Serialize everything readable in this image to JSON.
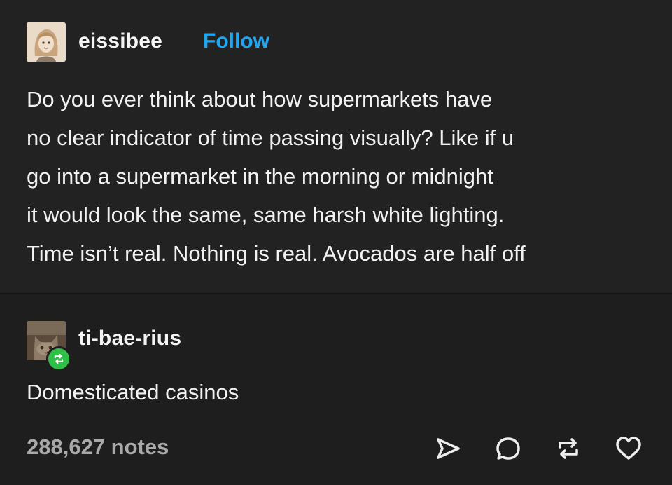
{
  "original_post": {
    "username": "eissibee",
    "follow_label": "Follow",
    "avatar_icon": "illustrated-character-avatar",
    "lines": [
      "Do you ever think about how supermarkets have",
      "no clear indicator of time passing visually? Like if u",
      "go into a supermarket in the morning or midnight",
      "it would look the same, same harsh white lighting.",
      "Time isn’t real. Nothing is real. Avocados are half off"
    ]
  },
  "reblog": {
    "username": "ti-bae-rius",
    "avatar_icon": "cat-photo-avatar",
    "badge_icon": "reblog-icon",
    "text": "Domesticated casinos"
  },
  "footer": {
    "notes": "288,627 notes",
    "actions": [
      "share-icon",
      "reply-icon",
      "reblog-icon",
      "like-icon"
    ]
  },
  "colors": {
    "background": "#1e1e1e",
    "follow": "#1ea7f2",
    "reblog_badge": "#2fc047",
    "notes_text": "#a9a9a9"
  }
}
